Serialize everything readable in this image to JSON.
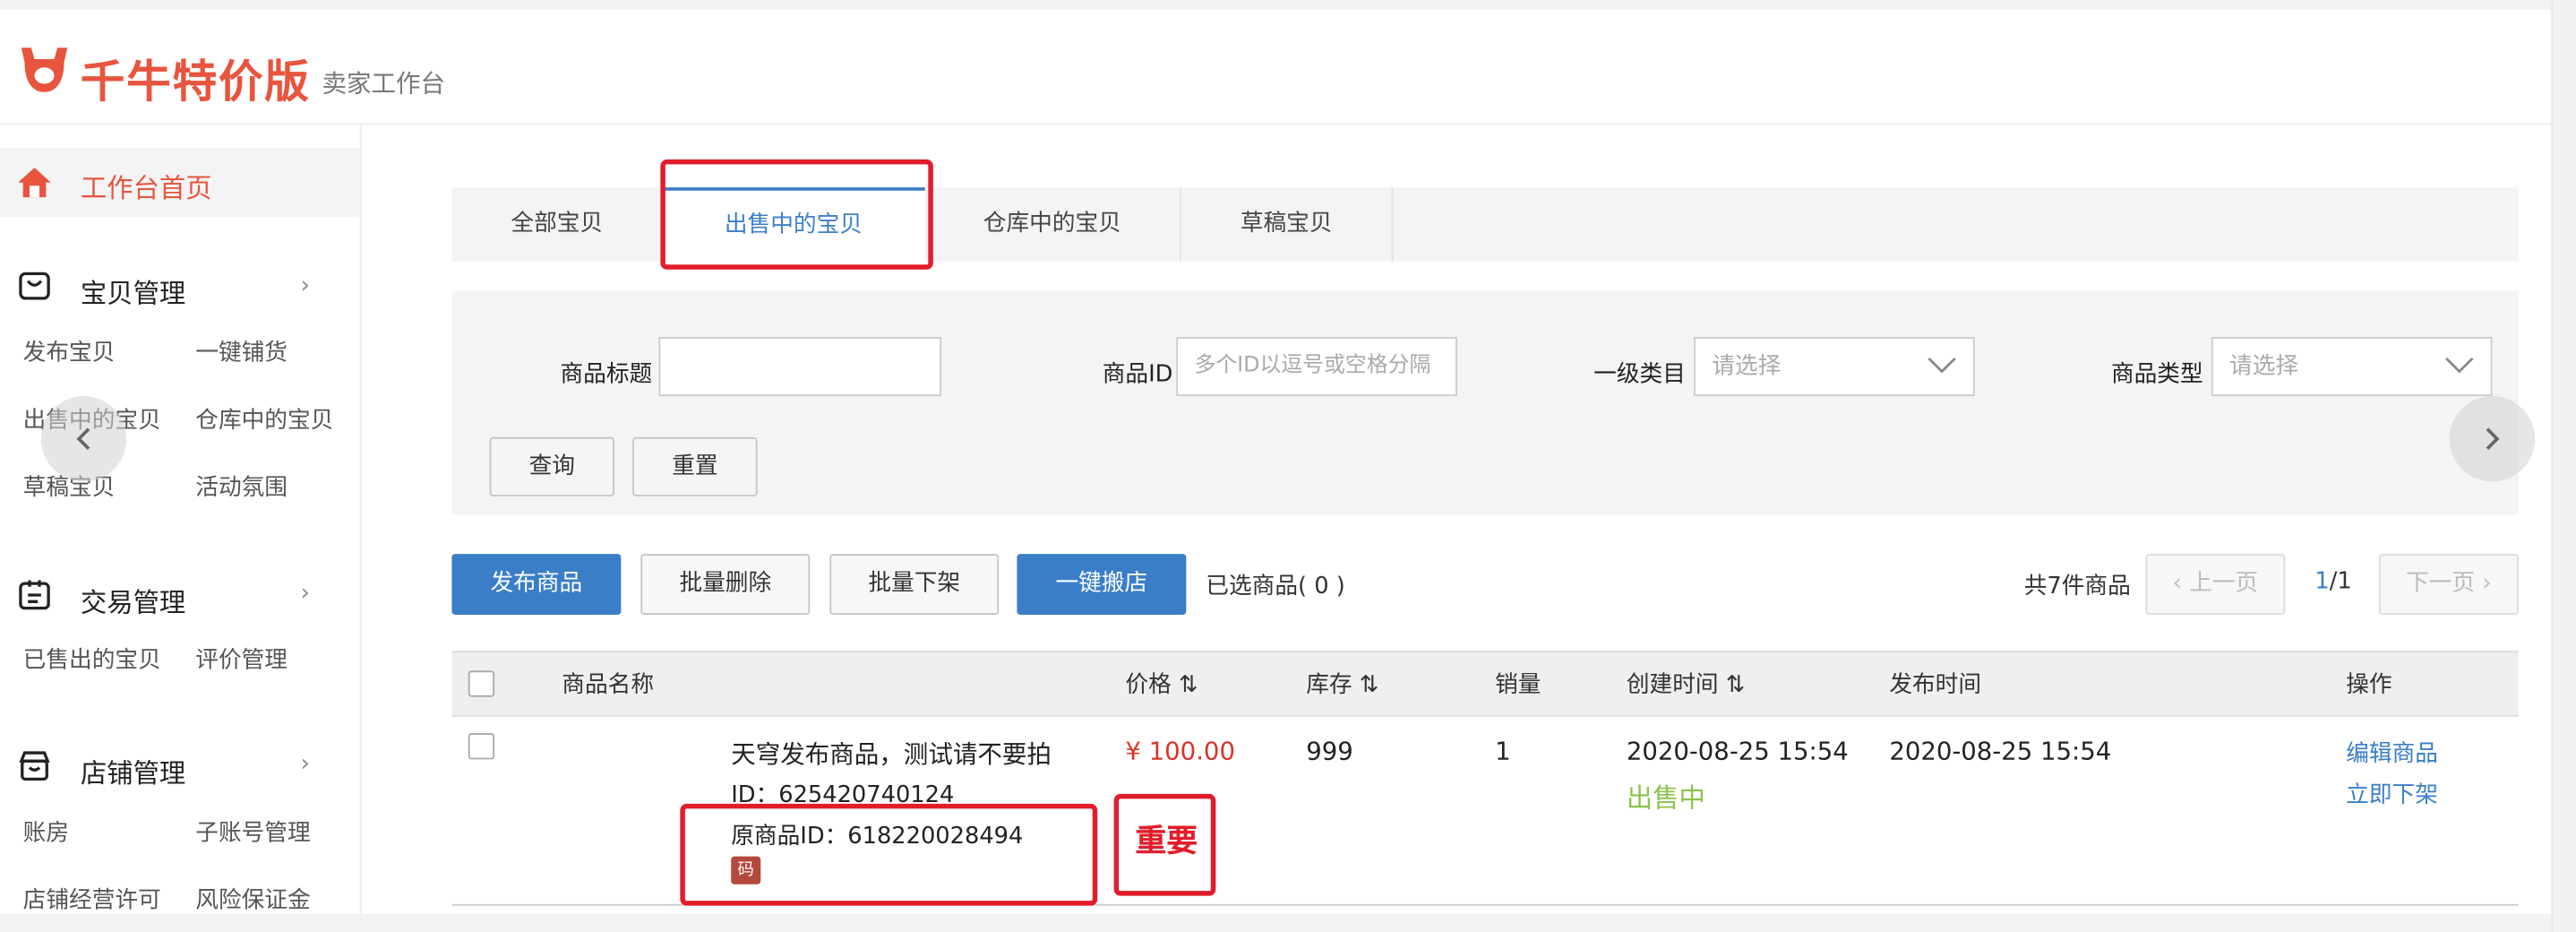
{
  "brand": {
    "name": "千牛特价版",
    "subtitle": "卖家工作台",
    "color": "#e8543e"
  },
  "sidebar": {
    "home": "工作台首页",
    "sections": [
      {
        "title": "宝贝管理",
        "icon": "bag-icon",
        "links": [
          "发布宝贝",
          "一键铺货",
          "出售中的宝贝",
          "仓库中的宝贝",
          "草稿宝贝",
          "活动氛围"
        ]
      },
      {
        "title": "交易管理",
        "icon": "clipboard-icon",
        "links": [
          "已售出的宝贝",
          "评价管理"
        ]
      },
      {
        "title": "店铺管理",
        "icon": "shop-icon",
        "links": [
          "账房",
          "子账号管理",
          "店铺经营许可",
          "风险保证金"
        ]
      }
    ]
  },
  "tabs": [
    "全部宝贝",
    "出售中的宝贝",
    "仓库中的宝贝",
    "草稿宝贝"
  ],
  "active_tab_index": 1,
  "filters": {
    "title_label": "商品标题",
    "title_value": "",
    "id_label": "商品ID",
    "id_placeholder": "多个ID以逗号或空格分隔",
    "category_label": "一级类目",
    "category_placeholder": "请选择",
    "type_label": "商品类型",
    "type_placeholder": "请选择",
    "query_button": "查询",
    "reset_button": "重置"
  },
  "actions": {
    "publish": "发布商品",
    "batch_delete": "批量删除",
    "batch_delist": "批量下架",
    "one_key_move": "一键搬店",
    "selected_label": "已选商品( 0 )"
  },
  "pagination": {
    "total": "共7件商品",
    "prev": "上一页",
    "current": "1",
    "pages": "/1",
    "next": "下一页"
  },
  "table": {
    "headers": {
      "name": "商品名称",
      "price": "价格",
      "stock": "库存",
      "sales": "销量",
      "created": "创建时间",
      "published": "发布时间",
      "ops": "操作"
    },
    "rows": [
      {
        "title": "天穹发布商品，测试请不要拍",
        "id": "ID：625420740124",
        "orig_id": "原商品ID：618220028494",
        "code_badge": "码",
        "price": "¥ 100.00",
        "stock": "999",
        "sales": "1",
        "created": "2020-08-25 15:54",
        "status": "出售中",
        "published": "2020-08-25 15:54",
        "op_edit": "编辑商品",
        "op_delist": "立即下架"
      }
    ]
  },
  "annotation": {
    "important": "重要",
    "color": "#e21d2b"
  },
  "colors": {
    "accent_blue": "#3a7ec8",
    "price_red": "#d9342b",
    "status_green": "#8bc34a"
  }
}
